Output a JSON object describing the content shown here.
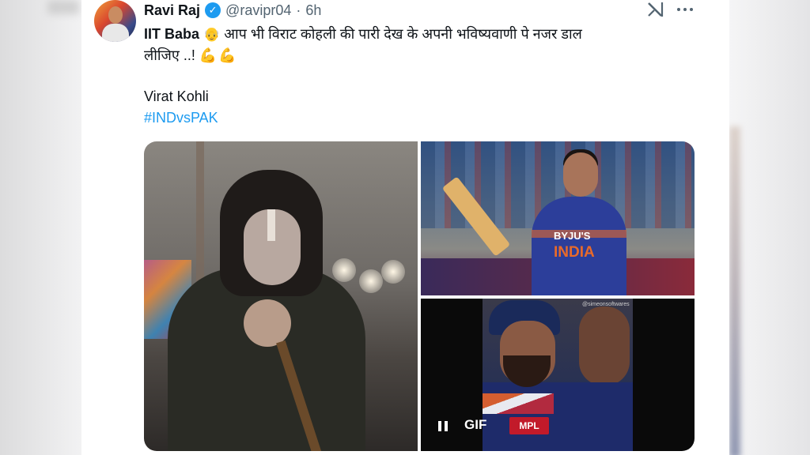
{
  "tweet": {
    "author_name": "Ravi Raj",
    "handle": "@ravipr04",
    "separator": "·",
    "time": "6h",
    "verified_mark": "✓",
    "lead_bold": "IIT Baba",
    "lead_emoji": "👴",
    "line1_text": " आप भी विराट कोहली की पारी देख के अपनी भविष्यवाणी पे नजर डाल",
    "line2_text": "लीजिए ..!",
    "line2_emojis": "💪💪",
    "line3": "Virat Kohli",
    "hashtag": "#INDvsPAK"
  },
  "media": {
    "tile2_jersey_brand": "BYJU'S",
    "tile2_jersey_country": "INDIA",
    "tile3_logo": "MPL",
    "tile3_watermark": "@simeonsoftwares",
    "gif_label": "GIF",
    "pause_icon": "pause-icon"
  },
  "icons": {
    "grok": "grok-icon",
    "more": "more-options-icon"
  },
  "colors": {
    "link": "#1d9bf0",
    "verified": "#1d9bf0",
    "text": "#0f1419",
    "muted": "#536471"
  }
}
